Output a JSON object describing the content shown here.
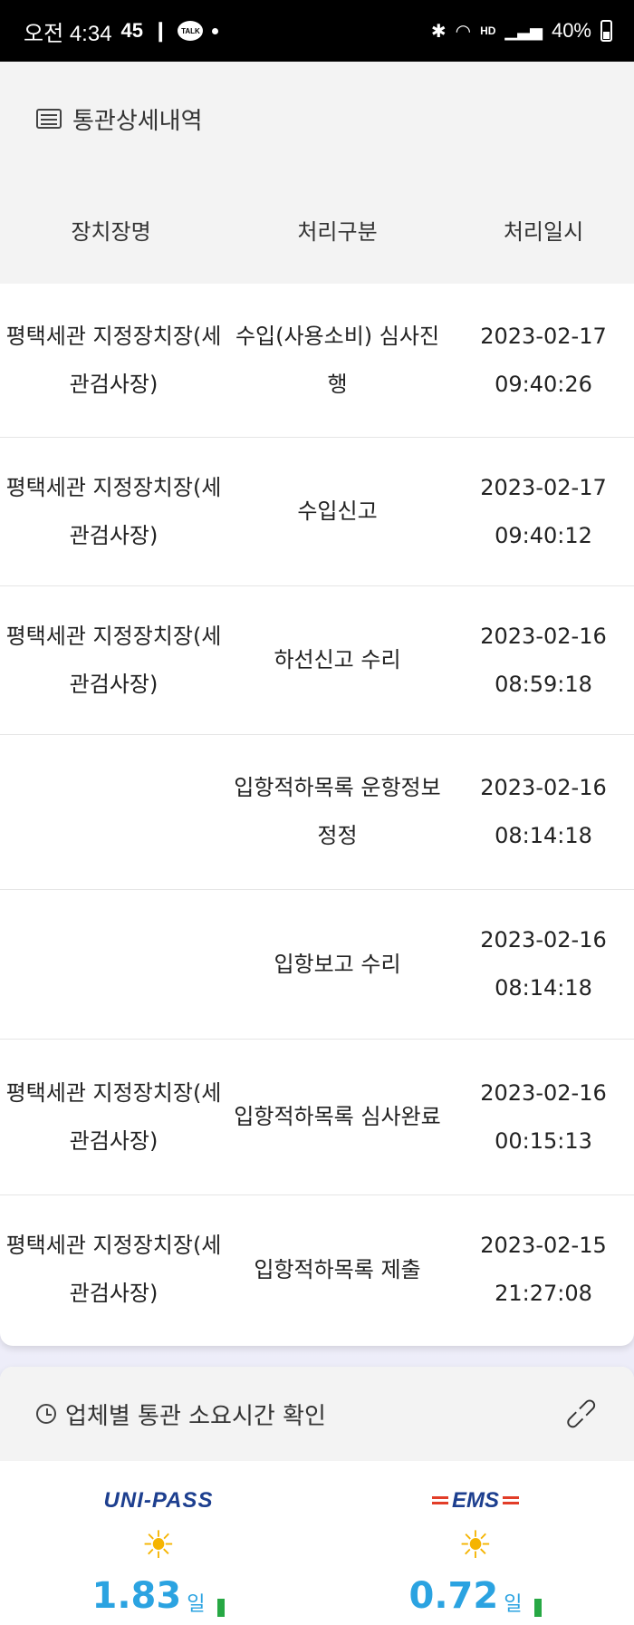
{
  "status_bar": {
    "time": "오전 4:34",
    "notif_count": "45",
    "talk": "TALK",
    "hd_label": "HD",
    "battery": "40%"
  },
  "detail_card": {
    "title": "통관상세내역",
    "columns": [
      "장치장명",
      "처리구분",
      "처리일시"
    ],
    "rows": [
      {
        "location": "평택세관 지정장치장(세관검사장)",
        "type": "수입(사용소비) 심사진행",
        "date": "2023-02-17",
        "time": "09:40:26"
      },
      {
        "location": "평택세관 지정장치장(세관검사장)",
        "type": "수입신고",
        "date": "2023-02-17",
        "time": "09:40:12"
      },
      {
        "location": "평택세관 지정장치장(세관검사장)",
        "type": "하선신고 수리",
        "date": "2023-02-16",
        "time": "08:59:18"
      },
      {
        "location": "",
        "type": "입항적하목록 운항정보 정정",
        "date": "2023-02-16",
        "time": "08:14:18"
      },
      {
        "location": "",
        "type": "입항보고 수리",
        "date": "2023-02-16",
        "time": "08:14:18"
      },
      {
        "location": "평택세관 지정장치장(세관검사장)",
        "type": "입항적하목록 심사완료",
        "date": "2023-02-16",
        "time": "00:15:13"
      },
      {
        "location": "평택세관 지정장치장(세관검사장)",
        "type": "입항적하목록 제출",
        "date": "2023-02-15",
        "time": "21:27:08"
      }
    ]
  },
  "time_card": {
    "title": "업체별 통관 소요시간 확인",
    "providers": [
      {
        "logo": "UNI-PASS",
        "value": "1.83",
        "unit": "일"
      },
      {
        "logo": "EMS",
        "value": "0.72",
        "unit": "일"
      }
    ]
  }
}
